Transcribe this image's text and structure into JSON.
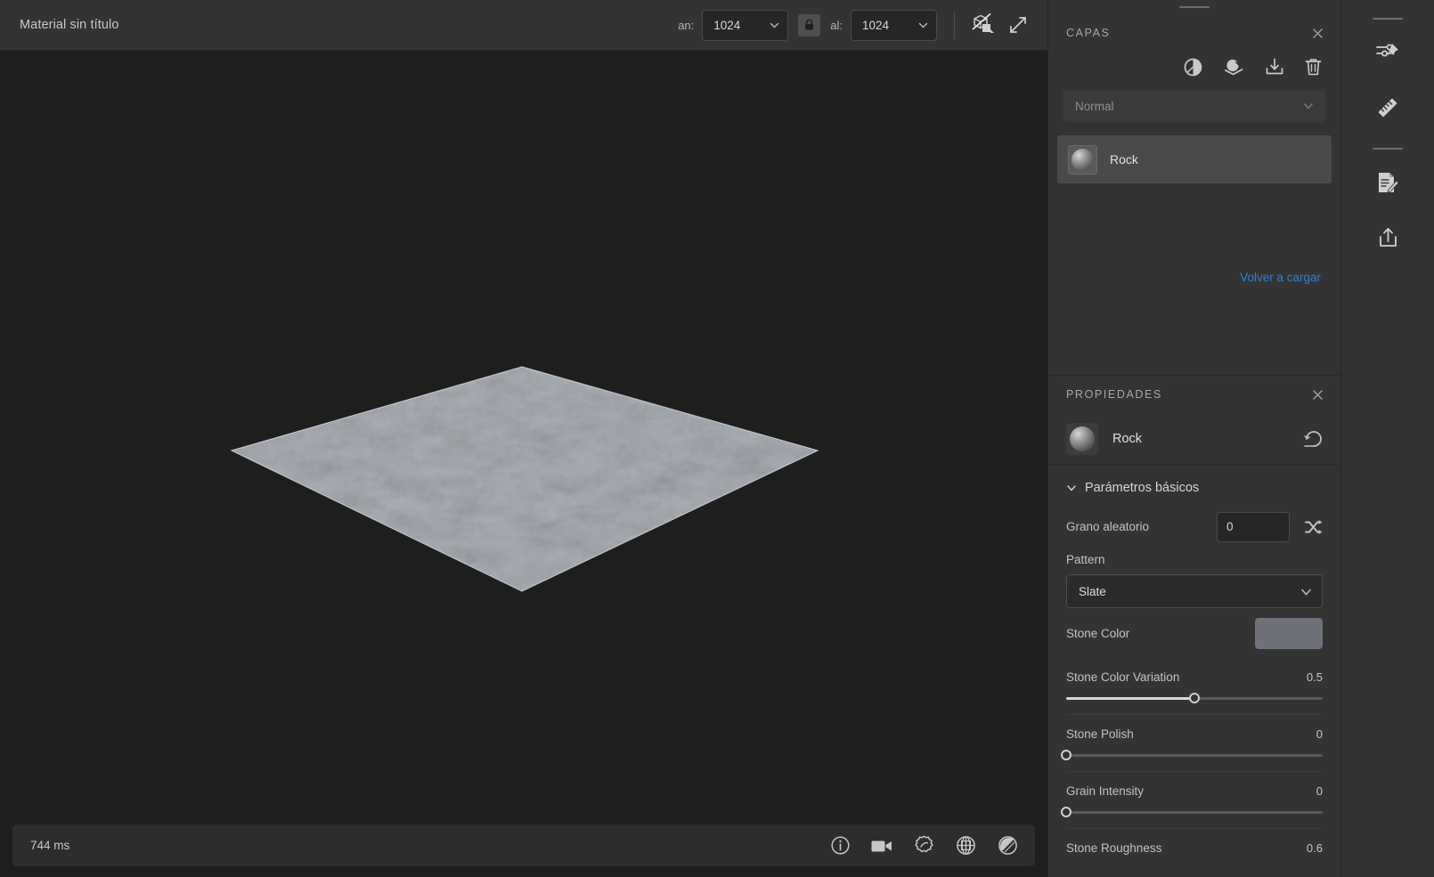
{
  "app": {
    "document_title": "Material sin título",
    "accent_link_color": "#2f7fd0"
  },
  "toolbar": {
    "width_label": "an:",
    "width_value": "1024",
    "height_label": "al:",
    "height_value": "1024",
    "lock_icon": "lock-icon",
    "view_toggle_icon": "3d-2d-toggle-icon",
    "expand_icon": "expand-icon"
  },
  "viewport": {
    "object": "textured-plane",
    "material_color": "#a9aeb4"
  },
  "statusbar": {
    "render_time": "744 ms",
    "icons": [
      {
        "name": "info-icon"
      },
      {
        "name": "camera-icon"
      },
      {
        "name": "environment-icon"
      },
      {
        "name": "tiling-icon"
      },
      {
        "name": "shading-icon"
      }
    ]
  },
  "layers_panel": {
    "title": "CAPAS",
    "close_icon": "close-icon",
    "tools": [
      {
        "name": "adjustment-layer-icon"
      },
      {
        "name": "add-layer-icon"
      },
      {
        "name": "import-layer-icon"
      },
      {
        "name": "delete-layer-icon"
      }
    ],
    "blend_mode": "Normal",
    "layers": [
      {
        "name": "Rock"
      }
    ],
    "reload_link": "Volver a cargar"
  },
  "properties_panel": {
    "title": "PROPIEDADES",
    "close_icon": "close-icon",
    "item_name": "Rock",
    "reset_icon": "reset-icon",
    "section": {
      "label": "Parámetros básicos",
      "expanded": true
    },
    "params": {
      "random_seed": {
        "label": "Grano aleatorio",
        "value": "0",
        "shuffle_icon": "shuffle-icon"
      },
      "pattern": {
        "label": "Pattern",
        "value": "Slate"
      },
      "stone_color": {
        "label": "Stone Color",
        "swatch": "#6e7178"
      },
      "stone_color_variation": {
        "label": "Stone Color Variation",
        "value": "0.5",
        "fill_percent": 50
      },
      "stone_polish": {
        "label": "Stone Polish",
        "value": "0",
        "fill_percent": 0
      },
      "grain_intensity": {
        "label": "Grain Intensity",
        "value": "0",
        "fill_percent": 0
      },
      "stone_roughness": {
        "label": "Stone Roughness",
        "value": "0.6",
        "fill_percent": 60
      }
    }
  },
  "rail": {
    "buttons": [
      {
        "name": "parameters-pin-icon"
      },
      {
        "name": "ruler-icon"
      },
      {
        "name": "document-edit-icon"
      },
      {
        "name": "export-icon"
      }
    ]
  }
}
